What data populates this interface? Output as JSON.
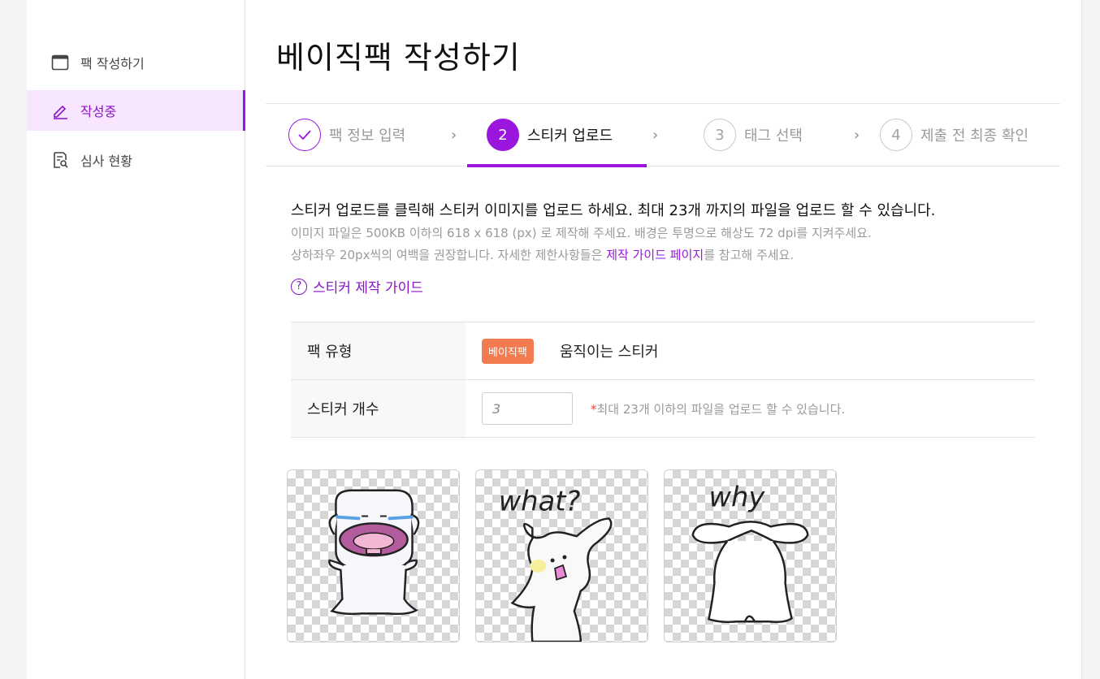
{
  "sidebar": {
    "items": [
      {
        "label": "팩 작성하기",
        "icon": "window-icon"
      },
      {
        "label": "작성중",
        "icon": "pencil-icon"
      },
      {
        "label": "심사 현황",
        "icon": "document-search-icon"
      }
    ]
  },
  "page": {
    "title": "베이직팩 작성하기"
  },
  "steps": [
    {
      "number": "1",
      "label": "팩 정보 입력",
      "state": "done"
    },
    {
      "number": "2",
      "label": "스티커 업로드",
      "state": "current"
    },
    {
      "number": "3",
      "label": "태그 선택",
      "state": "pending"
    },
    {
      "number": "4",
      "label": "제출 전 최종 확인",
      "state": "pending"
    }
  ],
  "description": {
    "main": "스티커 업로드를 클릭해 스티커 이미지를 업로드 하세요. 최대 23개 까지의 파일을 업로드 할 수 있습니다.",
    "line1": "이미지 파일은 500KB 이하의 618 x 618 (px) 로 제작해 주세요. 배경은 투명으로 해상도 72 dpi를 지켜주세요.",
    "line2_prefix": "상하좌우 20px씩의 여백을 권장합니다. 자세한 제한사항들은 ",
    "line2_link": "제작 가이드 페이지",
    "line2_suffix": "를 참고해 주세요."
  },
  "guide_link": {
    "label": "스티커 제작 가이드"
  },
  "info_table": {
    "pack_type_label": "팩 유형",
    "pack_type_badge": "베이직팩",
    "pack_type_value": "움직이는 스티커",
    "count_label": "스티커 개수",
    "count_value": "3",
    "count_note_star": "*",
    "count_note": "최대 23개 이하의 파일을 업로드 할 수 있습니다."
  },
  "stickers": [
    {
      "caption": ""
    },
    {
      "caption": "what?"
    },
    {
      "caption": "why"
    }
  ],
  "colors": {
    "accent": "#9a16de",
    "badge": "#f27b4f"
  }
}
